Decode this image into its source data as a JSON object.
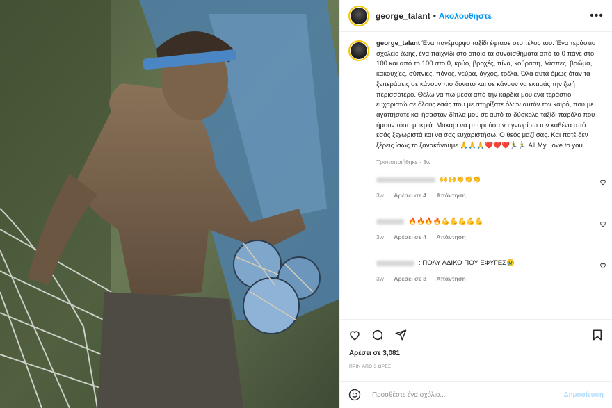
{
  "post": {
    "username": "george_talant",
    "follow_label": "Ακολουθήστε",
    "separator": "•",
    "more_label": "•••"
  },
  "caption": {
    "username": "george_talant",
    "text": "Ένα πανέμορφο ταξίδι έφτασε στο τέλος του. Ένα τεράστιο σχολείο ζωής, ένα παιχνίδι στο οποίο τα συναισθήματα από το 0 πάνε στο 100 και από το 100 στο 0, κρύο, βροχές, πίνα, κούραση, λάσπες, βρώμα, κακουχίες, σύπνιες, πόνος, νεύρα, άγχος, τρέλα. Όλα αυτά όμως όταν τα ξεπεράσεις σε κάνουν πιο δυνατό και σε κάνουν να εκτιμάς την ζωή περισσότερο. Θέλω να πω μέσα από την καρδιά μου ένα τεράστιο ευχαριστώ σε όλους εσάς που με στηρίξατε όλων αυτόν τον καιρό, που με αγαπήσατε και ήσασταν δίπλα μου σε αυτό το δύσκολο ταξίδι παρόλο που ήμουν τόσο μακριά. Μακάρι να μπορούσα να γνωρίσω τον καθένα από εσάς ξεχωριστά και να σας ευχαριστήσω. Ο θεός μαζί σας. Και ποτέ δεν ξέρεις ίσως το ξανακάνουμε 🙏🙏🙏❤️❤️❤️🏃‍♂️🏃‍♂️ All My Love to you",
    "edited": "Τροποποιήθηκε · 3w"
  },
  "comments": [
    {
      "text": "🙌🙌👏👏👏",
      "time": "3w",
      "likes": "Αρέσει σε 4",
      "reply": "Απάντηση"
    },
    {
      "text": "🔥🔥🔥🔥💪💪💪💪💪",
      "time": "3w",
      "likes": "Αρέσει σε 4",
      "reply": "Απάντηση"
    },
    {
      "text": ": ΠΟΛΥ ΑΔΙΚΟ ΠΟΥ ΕΦΥΓΕΣ😢",
      "time": "3w",
      "likes": "Αρέσει σε 8",
      "reply": "Απάντηση"
    }
  ],
  "footer": {
    "likes": "Αρέσει σε 3,081",
    "timestamp": "ΠΡΙΝ ΑΠΟ 3 ΩΡΕΣ",
    "comment_placeholder": "Προσθέστε ένα σχόλιο...",
    "post_label": "Δημοσίευση"
  },
  "colors": {
    "accent": "#0095f6",
    "post_disabled": "#b2dffc",
    "avatar_ring": "#f7c600"
  }
}
